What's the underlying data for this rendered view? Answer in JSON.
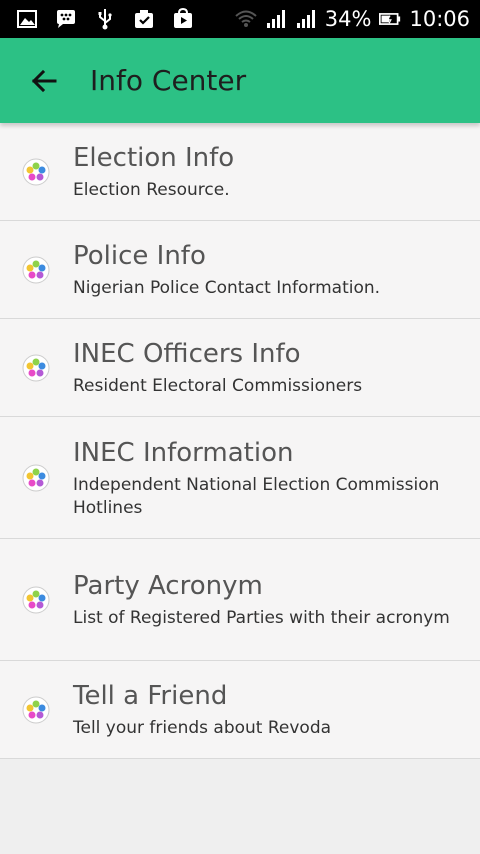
{
  "status_bar": {
    "battery_percent": "34%",
    "time": "10:06",
    "icons": [
      "image-icon",
      "bbm-icon",
      "usb-icon",
      "task-icon",
      "play-store-icon",
      "wifi-icon",
      "signal-icon",
      "signal-icon-2",
      "battery-icon"
    ]
  },
  "app_bar": {
    "title": "Info Center",
    "back_icon": "back-arrow-icon",
    "color": "#2cc185"
  },
  "items": [
    {
      "title": "Election Info",
      "subtitle": "Election Resource."
    },
    {
      "title": "Police Info",
      "subtitle": "Nigerian Police Contact Information."
    },
    {
      "title": "INEC Officers Info",
      "subtitle": "Resident Electoral Commissioners"
    },
    {
      "title": "INEC Information",
      "subtitle": "Independent National Election Commission Hotlines"
    },
    {
      "title": "Party Acronym",
      "subtitle": "List of Registered Parties with their acronym"
    },
    {
      "title": "Tell a Friend",
      "subtitle": "Tell your friends about Revoda"
    }
  ]
}
